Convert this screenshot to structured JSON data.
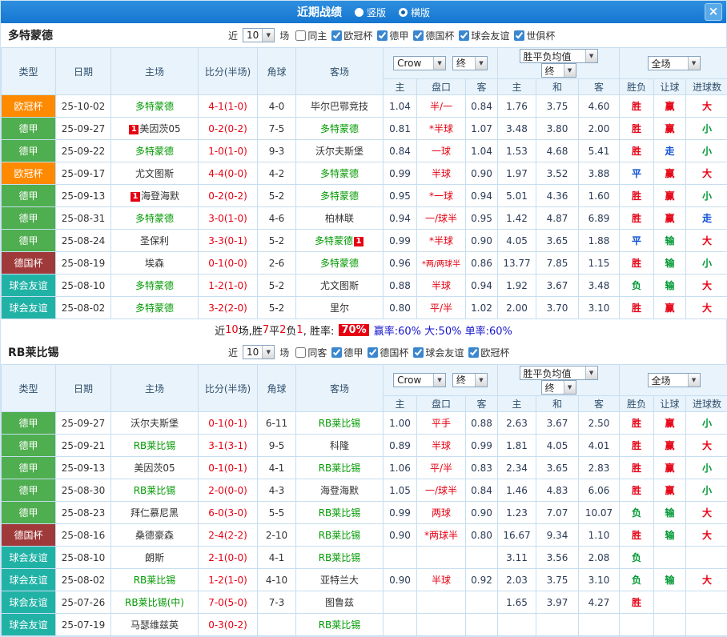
{
  "titlebar": {
    "title": "近期战绩",
    "vertical": "竖版",
    "horizontal": "横版",
    "close": "×"
  },
  "colors": {
    "titlebar": "#1576d1",
    "red": "#e60012",
    "blue": "#0b4fd6",
    "green": "#009933",
    "team_green": "#009900",
    "summary_blue": "#1717cf",
    "header_bg": "#e9f3fb",
    "border": "#c6def0"
  },
  "type_colors": {
    "欧冠杯": "#ff8a00",
    "德甲": "#4fae4f",
    "德国杯": "#a03a3a",
    "球会友谊": "#21b2a6"
  },
  "sections": [
    {
      "team": "多特蒙德",
      "near": "近",
      "count": "10",
      "matches": "场",
      "checkboxes": [
        {
          "label": "同主",
          "checked": false
        },
        {
          "label": "欧冠杯",
          "checked": true
        },
        {
          "label": "德甲",
          "checked": true
        },
        {
          "label": "德国杯",
          "checked": true
        },
        {
          "label": "球会友谊",
          "checked": true
        },
        {
          "label": "世俱杯",
          "checked": true
        }
      ],
      "dropdowns": {
        "odds": "Crow",
        "final1": "终",
        "avg": "胜平负均值",
        "final2": "终",
        "scope": "全场"
      },
      "columns": [
        "类型",
        "日期",
        "主场",
        "比分(半场)",
        "角球",
        "客场"
      ],
      "subcolumns": [
        "主",
        "盘口",
        "客",
        "主",
        "和",
        "客",
        "胜负",
        "让球",
        "进球数"
      ],
      "rows": [
        {
          "type": "欧冠杯",
          "date": "25-10-02",
          "home": "多特蒙德",
          "home_self": true,
          "score": "4-1(1-0)",
          "corner": "4-0",
          "away": "毕尔巴鄂竞技",
          "away_self": false,
          "o1": "1.04",
          "hcap": "半/一",
          "o2": "0.84",
          "a1": "1.76",
          "a2": "3.75",
          "a3": "4.60",
          "r1": "胜",
          "r2": "赢",
          "r3": "大"
        },
        {
          "type": "德甲",
          "date": "25-09-27",
          "home": "美因茨05",
          "home_self": false,
          "home_badge": "1",
          "home_badge_side": "l",
          "score": "0-2(0-2)",
          "corner": "7-5",
          "away": "多特蒙德",
          "away_self": true,
          "o1": "0.81",
          "hcap": "*半球",
          "o2": "1.07",
          "a1": "3.48",
          "a2": "3.80",
          "a3": "2.00",
          "r1": "胜",
          "r2": "赢",
          "r3": "小"
        },
        {
          "type": "德甲",
          "date": "25-09-22",
          "home": "多特蒙德",
          "home_self": true,
          "score": "1-0(1-0)",
          "corner": "9-3",
          "away": "沃尔夫斯堡",
          "away_self": false,
          "o1": "0.84",
          "hcap": "一球",
          "o2": "1.04",
          "a1": "1.53",
          "a2": "4.68",
          "a3": "5.41",
          "r1": "胜",
          "r2": "走",
          "r3": "小"
        },
        {
          "type": "欧冠杯",
          "date": "25-09-17",
          "home": "尤文图斯",
          "home_self": false,
          "score": "4-4(0-0)",
          "corner": "4-2",
          "away": "多特蒙德",
          "away_self": true,
          "o1": "0.99",
          "hcap": "半球",
          "o2": "0.90",
          "a1": "1.97",
          "a2": "3.52",
          "a3": "3.88",
          "r1": "平",
          "r2": "赢",
          "r3": "大"
        },
        {
          "type": "德甲",
          "date": "25-09-13",
          "home": "海登海默",
          "home_self": false,
          "home_badge": "1",
          "home_badge_side": "l",
          "score": "0-2(0-2)",
          "corner": "5-2",
          "away": "多特蒙德",
          "away_self": true,
          "o1": "0.95",
          "hcap": "*一球",
          "o2": "0.94",
          "a1": "5.01",
          "a2": "4.36",
          "a3": "1.60",
          "r1": "胜",
          "r2": "赢",
          "r3": "小"
        },
        {
          "type": "德甲",
          "date": "25-08-31",
          "home": "多特蒙德",
          "home_self": true,
          "score": "3-0(1-0)",
          "corner": "4-6",
          "away": "柏林联",
          "away_self": false,
          "o1": "0.94",
          "hcap": "一/球半",
          "o2": "0.95",
          "a1": "1.42",
          "a2": "4.87",
          "a3": "6.89",
          "r1": "胜",
          "r2": "赢",
          "r3": "走"
        },
        {
          "type": "德甲",
          "date": "25-08-24",
          "home": "圣保利",
          "home_self": false,
          "score": "3-3(0-1)",
          "corner": "5-2",
          "away": "多特蒙德",
          "away_self": true,
          "away_badge": "1",
          "away_badge_side": "r",
          "o1": "0.99",
          "hcap": "*半球",
          "o2": "0.90",
          "a1": "4.05",
          "a2": "3.65",
          "a3": "1.88",
          "r1": "平",
          "r2": "输",
          "r3": "大"
        },
        {
          "type": "德国杯",
          "date": "25-08-19",
          "home": "埃森",
          "home_self": false,
          "score": "0-1(0-0)",
          "corner": "2-6",
          "away": "多特蒙德",
          "away_self": true,
          "o1": "0.96",
          "hcap": "*两/两球半",
          "o2": "0.86",
          "a1": "13.77",
          "a2": "7.85",
          "a3": "1.15",
          "r1": "胜",
          "r2": "输",
          "r3": "小"
        },
        {
          "type": "球会友谊",
          "date": "25-08-10",
          "home": "多特蒙德",
          "home_self": true,
          "score": "1-2(1-0)",
          "corner": "5-2",
          "away": "尤文图斯",
          "away_self": false,
          "o1": "0.88",
          "hcap": "半球",
          "o2": "0.94",
          "a1": "1.92",
          "a2": "3.67",
          "a3": "3.48",
          "r1": "负",
          "r2": "输",
          "r3": "大"
        },
        {
          "type": "球会友谊",
          "date": "25-08-02",
          "home": "多特蒙德",
          "home_self": true,
          "score": "3-2(2-0)",
          "corner": "5-2",
          "away": "里尔",
          "away_self": false,
          "o1": "0.80",
          "hcap": "平/半",
          "o2": "1.02",
          "a1": "2.00",
          "a2": "3.70",
          "a3": "3.10",
          "r1": "胜",
          "r2": "赢",
          "r3": "大"
        }
      ],
      "summary": [
        {
          "t": "近",
          "s": "k"
        },
        {
          "t": "10",
          "s": "r"
        },
        {
          "t": "场,胜",
          "s": "k"
        },
        {
          "t": "7",
          "s": "r"
        },
        {
          "t": "平",
          "s": "k"
        },
        {
          "t": "2",
          "s": "r"
        },
        {
          "t": "负",
          "s": "k"
        },
        {
          "t": "1",
          "s": "r"
        },
        {
          "t": ", 胜率: ",
          "s": "k"
        },
        {
          "t": "70%",
          "s": "hl"
        },
        {
          "t": " 赢率:60%",
          "s": "b"
        },
        {
          "t": " 大:50%",
          "s": "b"
        },
        {
          "t": " 单率:60%",
          "s": "b"
        }
      ]
    },
    {
      "team": "RB莱比锡",
      "near": "近",
      "count": "10",
      "matches": "场",
      "checkboxes": [
        {
          "label": "同客",
          "checked": false
        },
        {
          "label": "德甲",
          "checked": true
        },
        {
          "label": "德国杯",
          "checked": true
        },
        {
          "label": "球会友谊",
          "checked": true
        },
        {
          "label": "欧冠杯",
          "checked": true
        }
      ],
      "dropdowns": {
        "odds": "Crow",
        "final1": "终",
        "avg": "胜平负均值",
        "final2": "终",
        "scope": "全场"
      },
      "columns": [
        "类型",
        "日期",
        "主场",
        "比分(半场)",
        "角球",
        "客场"
      ],
      "subcolumns": [
        "主",
        "盘口",
        "客",
        "主",
        "和",
        "客",
        "胜负",
        "让球",
        "进球数"
      ],
      "rows": [
        {
          "type": "德甲",
          "date": "25-09-27",
          "home": "沃尔夫斯堡",
          "home_self": false,
          "score": "0-1(0-1)",
          "corner": "6-11",
          "away": "RB莱比锡",
          "away_self": true,
          "o1": "1.00",
          "hcap": "平手",
          "o2": "0.88",
          "a1": "2.63",
          "a2": "3.67",
          "a3": "2.50",
          "r1": "胜",
          "r2": "赢",
          "r3": "小"
        },
        {
          "type": "德甲",
          "date": "25-09-21",
          "home": "RB莱比锡",
          "home_self": true,
          "score": "3-1(3-1)",
          "corner": "9-5",
          "away": "科隆",
          "away_self": false,
          "o1": "0.89",
          "hcap": "半球",
          "o2": "0.99",
          "a1": "1.81",
          "a2": "4.05",
          "a3": "4.01",
          "r1": "胜",
          "r2": "赢",
          "r3": "大"
        },
        {
          "type": "德甲",
          "date": "25-09-13",
          "home": "美因茨05",
          "home_self": false,
          "score": "0-1(0-1)",
          "corner": "4-1",
          "away": "RB莱比锡",
          "away_self": true,
          "o1": "1.06",
          "hcap": "平/半",
          "o2": "0.83",
          "a1": "2.34",
          "a2": "3.65",
          "a3": "2.83",
          "r1": "胜",
          "r2": "赢",
          "r3": "小"
        },
        {
          "type": "德甲",
          "date": "25-08-30",
          "home": "RB莱比锡",
          "home_self": true,
          "score": "2-0(0-0)",
          "corner": "4-3",
          "away": "海登海默",
          "away_self": false,
          "o1": "1.05",
          "hcap": "一/球半",
          "o2": "0.84",
          "a1": "1.46",
          "a2": "4.83",
          "a3": "6.06",
          "r1": "胜",
          "r2": "赢",
          "r3": "小"
        },
        {
          "type": "德甲",
          "date": "25-08-23",
          "home": "拜仁慕尼黑",
          "home_self": false,
          "score": "6-0(3-0)",
          "corner": "5-5",
          "away": "RB莱比锡",
          "away_self": true,
          "o1": "0.99",
          "hcap": "两球",
          "o2": "0.90",
          "a1": "1.23",
          "a2": "7.07",
          "a3": "10.07",
          "r1": "负",
          "r2": "输",
          "r3": "大"
        },
        {
          "type": "德国杯",
          "date": "25-08-16",
          "home": "桑德豪森",
          "home_self": false,
          "score": "2-4(2-2)",
          "corner": "2-10",
          "away": "RB莱比锡",
          "away_self": true,
          "o1": "0.90",
          "hcap": "*两球半",
          "o2": "0.80",
          "a1": "16.67",
          "a2": "9.34",
          "a3": "1.10",
          "r1": "胜",
          "r2": "输",
          "r3": "大"
        },
        {
          "type": "球会友谊",
          "date": "25-08-10",
          "home": "朗斯",
          "home_self": false,
          "score": "2-1(0-0)",
          "corner": "4-1",
          "away": "RB莱比锡",
          "away_self": true,
          "o1": "",
          "hcap": "",
          "o2": "",
          "a1": "3.11",
          "a2": "3.56",
          "a3": "2.08",
          "r1": "负",
          "r2": "",
          "r3": ""
        },
        {
          "type": "球会友谊",
          "date": "25-08-02",
          "home": "RB莱比锡",
          "home_self": true,
          "score": "1-2(1-0)",
          "corner": "4-10",
          "away": "亚特兰大",
          "away_self": false,
          "o1": "0.90",
          "hcap": "半球",
          "o2": "0.92",
          "a1": "2.03",
          "a2": "3.75",
          "a3": "3.10",
          "r1": "负",
          "r2": "输",
          "r3": "大"
        },
        {
          "type": "球会友谊",
          "date": "25-07-26",
          "home": "RB莱比锡(中)",
          "home_self": true,
          "score": "7-0(5-0)",
          "corner": "7-3",
          "away": "图鲁兹",
          "away_self": false,
          "o1": "",
          "hcap": "",
          "o2": "",
          "a1": "1.65",
          "a2": "3.97",
          "a3": "4.27",
          "r1": "胜",
          "r2": "",
          "r3": ""
        },
        {
          "type": "球会友谊",
          "date": "25-07-19",
          "home": "马瑟维兹英",
          "home_self": false,
          "score": "0-3(0-2)",
          "corner": "",
          "away": "RB莱比锡",
          "away_self": true,
          "o1": "",
          "hcap": "",
          "o2": "",
          "a1": "",
          "a2": "",
          "a3": "",
          "r1": "",
          "r2": "",
          "r3": ""
        }
      ],
      "summary": null
    }
  ]
}
